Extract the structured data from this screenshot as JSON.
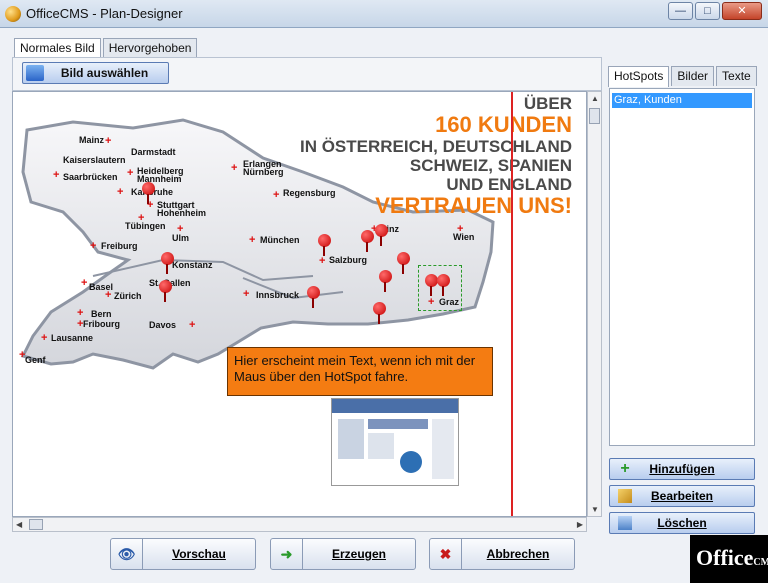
{
  "window": {
    "title": "OfficeCMS - Plan-Designer"
  },
  "tabs": [
    {
      "label": "Normales Bild",
      "active": true
    },
    {
      "label": "Hervorgehoben",
      "active": false
    }
  ],
  "toolbar": {
    "select_image_label": "Bild auswählen"
  },
  "headline": {
    "line1": "ÜBER",
    "line2": "160 KUNDEN",
    "line3": "IN ÖSTERREICH, DEUTSCHLAND",
    "line4": "SCHWEIZ, SPANIEN",
    "line5": "UND ENGLAND",
    "line6": "VERTRAUEN UNS!"
  },
  "cities": [
    "Mainz",
    "Darmstadt",
    "Kaiserslautern",
    "Heidelberg",
    "Mannheim",
    "Saarbrücken",
    "Erlangen",
    "Nürnberg",
    "Karlsruhe",
    "Regensburg",
    "Stuttgart",
    "Hohenheim",
    "Tübingen",
    "Ulm",
    "Linz",
    "Wien",
    "München",
    "Freiburg",
    "Konstanz",
    "Salzburg",
    "Basel",
    "St. Gallen",
    "Zürich",
    "Innsbruck",
    "Graz",
    "Bern",
    "Fribourg",
    "Davos",
    "Lausanne",
    "Genf"
  ],
  "tooltip_text": "Hier erscheint mein Text, wenn ich mit der Maus über den HotSpot fahre.",
  "right_tabs": [
    {
      "label": "HotSpots",
      "active": true
    },
    {
      "label": "Bilder",
      "active": false
    },
    {
      "label": "Texte",
      "active": false
    }
  ],
  "hotspot_list": [
    "Graz, Kunden"
  ],
  "side_buttons": {
    "add": "Hinzufügen",
    "edit": "Bearbeiten",
    "delete": "Löschen"
  },
  "footer_buttons": {
    "preview": "Vorschau",
    "generate": "Erzeugen",
    "cancel": "Abbrechen"
  },
  "logo": {
    "main": "Office",
    "sub": "CMS"
  },
  "colors": {
    "accent": "#f07a10",
    "selection": "#3399ff",
    "marker": "#d11111"
  }
}
